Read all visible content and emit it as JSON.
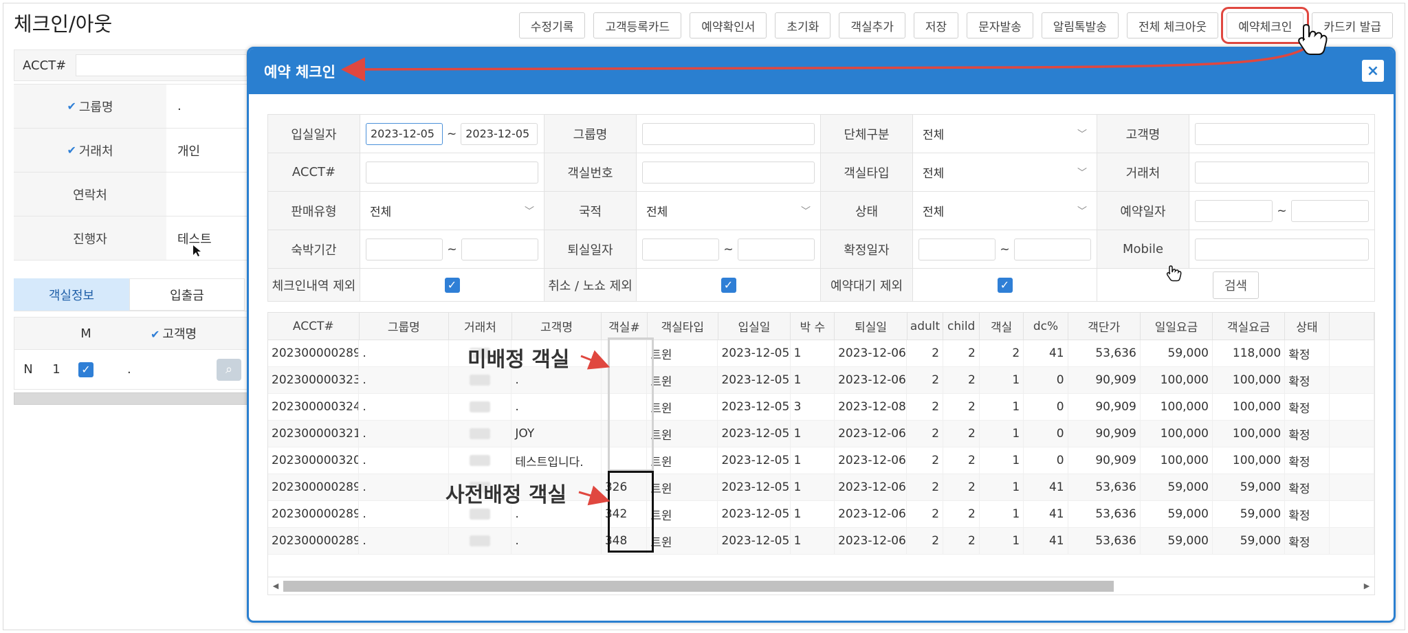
{
  "page": {
    "title": "체크인/아웃"
  },
  "toolbar": {
    "buttons": [
      {
        "label": "수정기록"
      },
      {
        "label": "고객등록카드"
      },
      {
        "label": "예약확인서"
      },
      {
        "label": "초기화"
      },
      {
        "label": "객실추가"
      },
      {
        "label": "저장"
      },
      {
        "label": "문자발송"
      },
      {
        "label": "알림톡발송"
      },
      {
        "label": "전체 체크아웃"
      },
      {
        "label": "예약체크인"
      },
      {
        "label": "카드키 발급"
      }
    ]
  },
  "left_panel": {
    "acct_label": "ACCT#",
    "rows": [
      {
        "label": "그룹명",
        "value": ".",
        "checked": true
      },
      {
        "label": "거래처",
        "value": "개인",
        "checked": true
      },
      {
        "label": "연락처",
        "value": "",
        "checked": false
      },
      {
        "label": "진행자",
        "value": "테스트",
        "checked": false
      }
    ],
    "tabs": [
      "객실정보",
      "입출금"
    ],
    "grid_head": {
      "m": "M",
      "guest": "고객명"
    },
    "grid_row": {
      "flag": "N",
      "num": "1",
      "guest": "."
    }
  },
  "modal": {
    "title": "예약 체크인",
    "close": "×",
    "search": {
      "checkin_date": {
        "label": "입실일자",
        "from": "2023-12-05",
        "tilde": "~",
        "to": "2023-12-05"
      },
      "group_name": {
        "label": "그룹명"
      },
      "group_type": {
        "label": "단체구분",
        "value": "전체"
      },
      "guest_name": {
        "label": "고객명"
      },
      "acct": {
        "label": "ACCT#"
      },
      "room_no": {
        "label": "객실번호"
      },
      "room_type": {
        "label": "객실타입",
        "value": "전체"
      },
      "client": {
        "label": "거래처"
      },
      "sales_type": {
        "label": "판매유형",
        "value": "전체"
      },
      "nationality": {
        "label": "국적",
        "value": "전체"
      },
      "status": {
        "label": "상태",
        "value": "전체"
      },
      "reserve_date": {
        "label": "예약일자",
        "tilde": "~"
      },
      "stay_period": {
        "label": "숙박기간",
        "tilde": "~"
      },
      "checkout_date": {
        "label": "퇴실일자",
        "tilde": "~"
      },
      "confirm_date": {
        "label": "확정일자",
        "tilde": "~"
      },
      "mobile": {
        "label": "Mobile"
      },
      "exclude_checkin": {
        "label": "체크인내역 제외",
        "checked": true
      },
      "exclude_cancel": {
        "label": "취소 / 노쇼 제외",
        "checked": true
      },
      "exclude_waiting": {
        "label": "예약대기 제외",
        "checked": true
      },
      "search_button": "검색"
    },
    "grid": {
      "columns": [
        "ACCT#",
        "그룹명",
        "거래처",
        "고객명",
        "객실#",
        "객실타입",
        "입실일",
        "박 수",
        "퇴실일",
        "adult",
        "child",
        "객실",
        "dc%",
        "객단가",
        "일일요금",
        "객실요금",
        "상태"
      ],
      "rows": [
        [
          "202300000289",
          ".",
          "",
          "",
          "",
          "트윈",
          "2023-12-05",
          "1",
          "2023-12-06",
          "2",
          "2",
          "2",
          "41",
          "53,636",
          "59,000",
          "118,000",
          "확정"
        ],
        [
          "202300000323",
          ".",
          "",
          ".",
          "",
          "트윈",
          "2023-12-05",
          "1",
          "2023-12-06",
          "2",
          "2",
          "1",
          "0",
          "90,909",
          "100,000",
          "100,000",
          "확정"
        ],
        [
          "202300000324",
          ".",
          "",
          ".",
          "",
          "트윈",
          "2023-12-05",
          "3",
          "2023-12-08",
          "2",
          "2",
          "1",
          "0",
          "90,909",
          "100,000",
          "100,000",
          "확정"
        ],
        [
          "202300000321",
          ".",
          "",
          "JOY",
          "",
          "트윈",
          "2023-12-05",
          "1",
          "2023-12-06",
          "2",
          "2",
          "1",
          "0",
          "90,909",
          "100,000",
          "100,000",
          "확정"
        ],
        [
          "202300000320",
          ".",
          "",
          "테스트입니다.",
          "",
          "트윈",
          "2023-12-05",
          "1",
          "2023-12-06",
          "2",
          "2",
          "1",
          "0",
          "90,909",
          "100,000",
          "100,000",
          "확정"
        ],
        [
          "202300000289",
          ".",
          "",
          "",
          "326",
          "트윈",
          "2023-12-05",
          "1",
          "2023-12-06",
          "2",
          "2",
          "1",
          "41",
          "53,636",
          "59,000",
          "59,000",
          "확정"
        ],
        [
          "202300000289",
          ".",
          "",
          ".",
          "342",
          "트윈",
          "2023-12-05",
          "1",
          "2023-12-06",
          "2",
          "2",
          "1",
          "41",
          "53,636",
          "59,000",
          "59,000",
          "확정"
        ],
        [
          "202300000289",
          ".",
          "",
          ".",
          "348",
          "트윈",
          "2023-12-05",
          "1",
          "2023-12-06",
          "2",
          "2",
          "1",
          "41",
          "53,636",
          "59,000",
          "59,000",
          "확정"
        ]
      ]
    }
  },
  "annotations": {
    "unassigned": "미배정 객실",
    "preassigned": "사전배정 객실"
  },
  "colors": {
    "accent": "#2a7fd0",
    "highlight": "#e0473f",
    "checkbox": "#2f7fd6"
  }
}
